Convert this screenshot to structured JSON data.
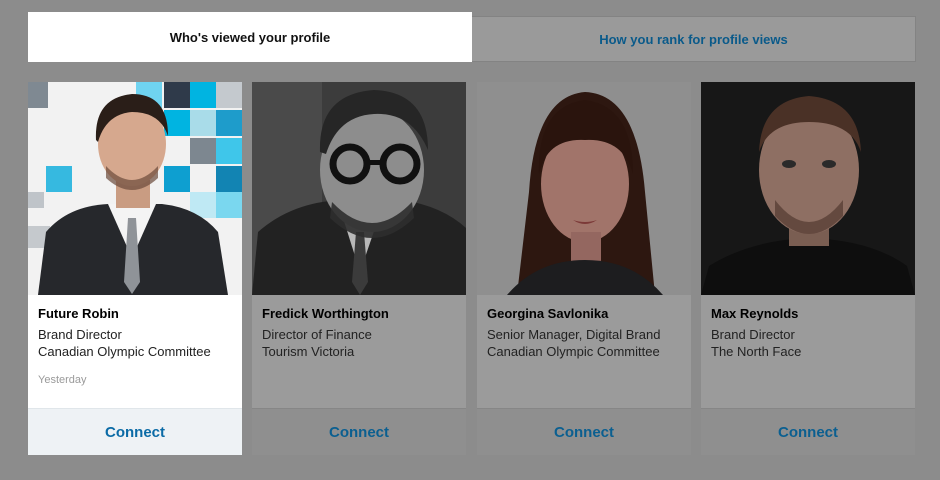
{
  "tabs": {
    "active_label": "Who's viewed your profile",
    "inactive_label": "How you rank for profile views"
  },
  "cards": [
    {
      "name": "Future Robin",
      "title": "Brand Director",
      "company": "Canadian Olympic Committee",
      "time": "Yesterday",
      "action": "Connect"
    },
    {
      "name": "Fredick Worthington",
      "title": "Director of Finance",
      "company": "Tourism Victoria",
      "action": "Connect"
    },
    {
      "name": "Georgina Savlonika",
      "title": "Senior Manager, Digital Brand",
      "company": "Canadian Olympic Committee",
      "action": "Connect"
    },
    {
      "name": "Max Reynolds",
      "title": "Brand Director",
      "company": "The North Face",
      "action": "Connect"
    }
  ],
  "colors": {
    "overlay": "#8c8c8c",
    "link": "#0b5f90",
    "card_dim": "#9b9b9b",
    "card_active": "#ffffff"
  }
}
